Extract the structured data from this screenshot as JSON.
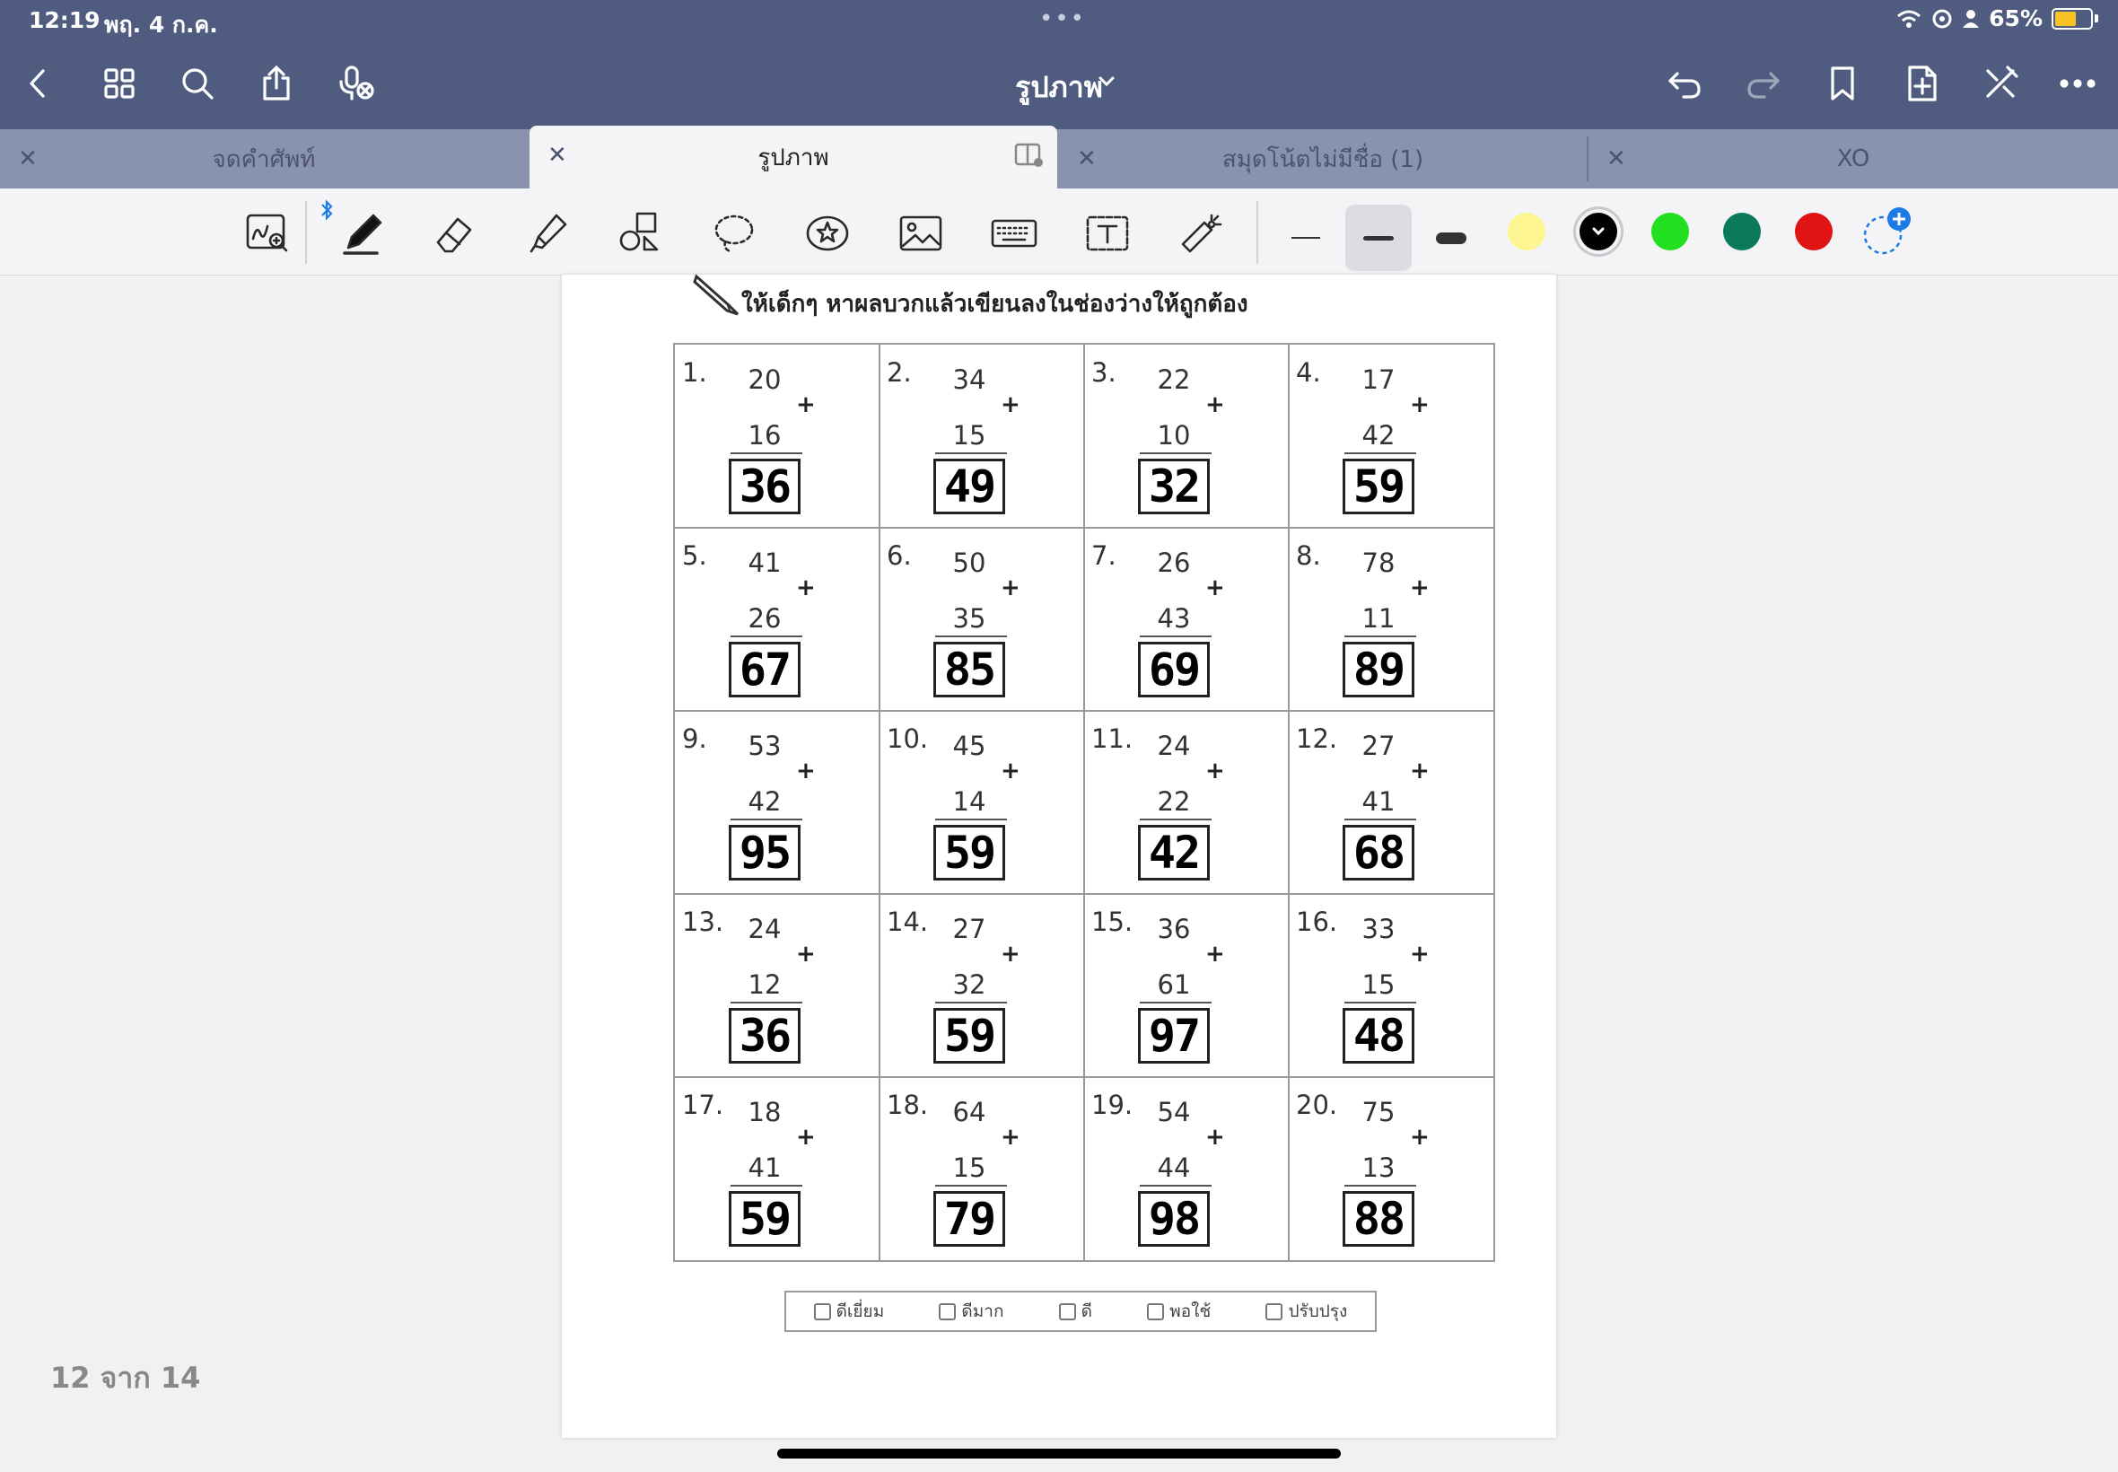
{
  "status": {
    "time": "12:19",
    "date": "พฤ. 4 ก.ค.",
    "battery": "65%",
    "battery_level": 0.65
  },
  "nav": {
    "title": "รูปภาพ"
  },
  "tabs": [
    {
      "label": "จดคำศัพท์",
      "active": false
    },
    {
      "label": "รูปภาพ",
      "active": true
    },
    {
      "label": "สมุดโน้ตไม่มีชื่อ (1)",
      "active": false
    },
    {
      "label": "XO",
      "active": false
    }
  ],
  "colors": {
    "nav_bg": "#4f5c80",
    "swatches": [
      "#fdf58f",
      "#000000",
      "#22e01f",
      "#0a7a5a",
      "#e01414"
    ]
  },
  "worksheet": {
    "instruction": "ให้เด็กๆ หาผลบวกแล้วเขียนลงในช่องว่างให้ถูกต้อง",
    "problems": [
      {
        "num": "1.",
        "a": "20",
        "b": "16",
        "ans": "36"
      },
      {
        "num": "2.",
        "a": "34",
        "b": "15",
        "ans": "49"
      },
      {
        "num": "3.",
        "a": "22",
        "b": "10",
        "ans": "32"
      },
      {
        "num": "4.",
        "a": "17",
        "b": "42",
        "ans": "59"
      },
      {
        "num": "5.",
        "a": "41",
        "b": "26",
        "ans": "67"
      },
      {
        "num": "6.",
        "a": "50",
        "b": "35",
        "ans": "85"
      },
      {
        "num": "7.",
        "a": "26",
        "b": "43",
        "ans": "69"
      },
      {
        "num": "8.",
        "a": "78",
        "b": "11",
        "ans": "89"
      },
      {
        "num": "9.",
        "a": "53",
        "b": "42",
        "ans": "95"
      },
      {
        "num": "10.",
        "a": "45",
        "b": "14",
        "ans": "59"
      },
      {
        "num": "11.",
        "a": "24",
        "b": "22",
        "ans": "42"
      },
      {
        "num": "12.",
        "a": "27",
        "b": "41",
        "ans": "68"
      },
      {
        "num": "13.",
        "a": "24",
        "b": "12",
        "ans": "36"
      },
      {
        "num": "14.",
        "a": "27",
        "b": "32",
        "ans": "59"
      },
      {
        "num": "15.",
        "a": "36",
        "b": "61",
        "ans": "97"
      },
      {
        "num": "16.",
        "a": "33",
        "b": "15",
        "ans": "48"
      },
      {
        "num": "17.",
        "a": "18",
        "b": "41",
        "ans": "59"
      },
      {
        "num": "18.",
        "a": "64",
        "b": "15",
        "ans": "79"
      },
      {
        "num": "19.",
        "a": "54",
        "b": "44",
        "ans": "98"
      },
      {
        "num": "20.",
        "a": "75",
        "b": "13",
        "ans": "88"
      }
    ],
    "plus_sign": "+",
    "rating": [
      "ดีเยี่ยม",
      "ดีมาก",
      "ดี",
      "พอใช้",
      "ปรับปรุง"
    ]
  },
  "page_indicator": "12 จาก 14"
}
